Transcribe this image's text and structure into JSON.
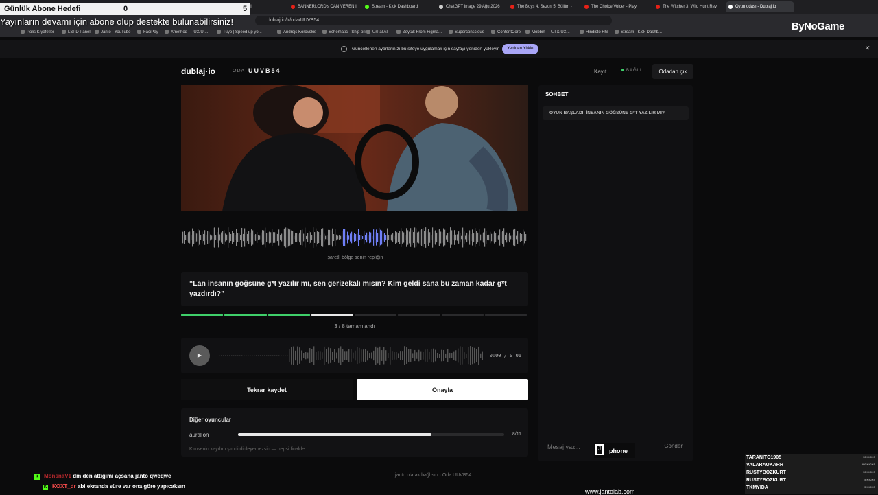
{
  "browser": {
    "tabs": [
      {
        "label": "RD's CAN VEREN I",
        "color": "#e62117"
      },
      {
        "label": "BANNERLORD's CAN VEREN I",
        "color": "#e62117"
      },
      {
        "label": "Stream - Kick Dashboard",
        "color": "#53fc18"
      },
      {
        "label": "ChatGPT Image 29 Ağu 2026",
        "color": "#cccccc"
      },
      {
        "label": "The Boys 4. Sezon 5. Bölüm -",
        "color": "#e62117"
      },
      {
        "label": "The Choice Voicer - Play",
        "color": "#e62117"
      },
      {
        "label": "The Witcher 3: Wild Hunt Rev",
        "color": "#e62117"
      },
      {
        "label": "Oyun odası - Dublaj.io",
        "color": "#ffffff"
      }
    ],
    "url": "dublaj.io/tr/oda/UUVB54",
    "bookmarks": [
      "Polis Kıyafetler",
      "LSPD Panel",
      "Janto - YouTube",
      "FaciPay",
      "Xmethod — UX/UI...",
      "Tuyo | Speed up yo...",
      "Andrejs Korovskis",
      "Schematic - Ship pri...",
      "UrPal AI",
      "Zeytal: From Figma...",
      "Superconscious",
      "ContentCore",
      "Mobbin — UI & UX...",
      "Hindisto HG",
      "Stream - Kick Dashb..."
    ],
    "infobar": {
      "text": "Güncellenen ayarlarınızı bu siteye uygulamak için sayfayı yeniden yükleyin",
      "button": "Yeniden Yükle"
    }
  },
  "overlay": {
    "goal_label": "Günlük Abone Hedefi",
    "goal_current": "0",
    "goal_target": "5",
    "banner": "Yayınların devamı için abone olup destekte bulunabilirsiniz!",
    "brand": "ByNoGame",
    "chat_lines": [
      {
        "user": "MonsnaV1",
        "text": "dm den attığımı açsana janto qweqwe",
        "color": "#ff4d4d"
      },
      {
        "user": "KOXT_dr",
        "text": "abi ekranda süre var ona göre yapıcaksın",
        "color": "#ff4d4d"
      }
    ],
    "leaderboard": [
      {
        "name": "TARANITO1905",
        "value": "10 KICKS"
      },
      {
        "name": "VALARAUKARR",
        "value": "500 KICKS"
      },
      {
        "name": "RUSTYBOZKURT",
        "value": "10 KICKS"
      },
      {
        "name": "RUSTYBOZKURT",
        "value": "5 KICKS"
      },
      {
        "name": "TKMYIDA",
        "value": "5 KICKS"
      }
    ],
    "website": "www.jantolab.com",
    "sponsor": "phone"
  },
  "app": {
    "logo": "dublaj·io",
    "room_label": "ODA",
    "room_code": "UUVB54",
    "nav_record": "Kayıt",
    "status": "BAĞLI",
    "leave": "Odadan çık",
    "marked_caption": "İşaretli bölge senin repliğin",
    "quote": "“Lan insanın göğsüne g*t yazılır mı, sen gerizekalı mısın? Kim geldi sana bu zaman kadar g*t yazdırdı?”",
    "progress_text": "3 / 8 tamamlandı",
    "progress": {
      "completed": 3,
      "current": 4,
      "total": 8
    },
    "player_time": "0:00 / 0:06",
    "btn_retake": "Tekrar kaydet",
    "btn_confirm": "Onayla",
    "others_title": "Diğer oyuncular",
    "others": [
      {
        "name": "auralion",
        "count": "8/11",
        "fraction": 0.727
      }
    ],
    "others_note": "Kimsenin kaydını şimdi dinleyemezsin — hepsi finalde.",
    "chat_title": "SOHBET",
    "chat_message": "OYUN BAŞLADI: İNSANIN GÖĞSÜNE G*T YAZILIR MI?",
    "chat_placeholder": "Mesaj yaz...",
    "chat_send": "Gönder",
    "footer": "janto olarak bağlısın · Oda UUVB54"
  }
}
